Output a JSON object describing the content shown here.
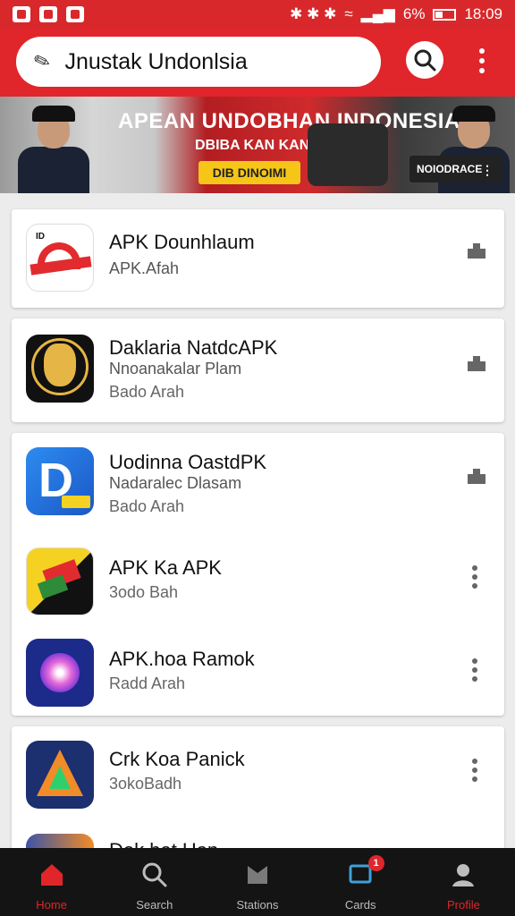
{
  "status_bar": {
    "right_icons": "✱ ✱ ✱",
    "battery_text": "6%",
    "time": "18:09"
  },
  "search": {
    "query": "Jnustak Undonlsia"
  },
  "banner": {
    "title": "APEAN UNDOBHAN INDONESIA",
    "subtitle": "DBIBA KAN KANBS",
    "cta": "DIB DINOIMI",
    "label": "NOIODRACE"
  },
  "apps": [
    {
      "name": "APK Dounhlaum",
      "line2": "APK.Afah",
      "line3": ""
    },
    {
      "name": "Daklaria NatdcAPK",
      "line2": "Nnoanakalar Plam",
      "line3": "Bado Arah"
    },
    {
      "name": "Uodinna OastdPK",
      "line2": "Nadaralec Dlasam",
      "line3": "Bado Arah"
    },
    {
      "name": "APK Ka APK",
      "line2": "3odo Bah",
      "line3": ""
    },
    {
      "name": "APK.hoa Ramok",
      "line2": "Radd Arah",
      "line3": ""
    },
    {
      "name": "Crk Koa Panick",
      "line2": "3okoBadh",
      "line3": ""
    },
    {
      "name": "Dok bat Han",
      "line2": "",
      "line3": ""
    }
  ],
  "bottom_nav": [
    {
      "label": "Home",
      "icon": "home-icon"
    },
    {
      "label": "Search",
      "icon": "search-icon"
    },
    {
      "label": "Stations",
      "icon": "store-icon"
    },
    {
      "label": "Cards",
      "icon": "inbox-icon",
      "badge": "1"
    },
    {
      "label": "Profile",
      "icon": "profile-icon"
    }
  ],
  "colors": {
    "primary": "#e0262b",
    "nav_bg": "#141414",
    "page_bg": "#ececec"
  }
}
